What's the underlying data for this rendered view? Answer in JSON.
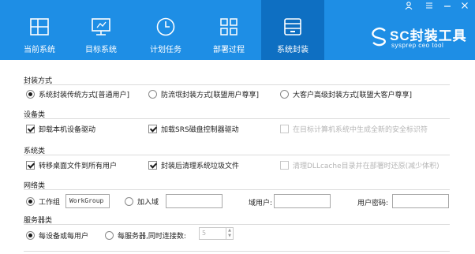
{
  "window": {
    "controls": [
      "user",
      "menu",
      "minimize",
      "close"
    ]
  },
  "tabs": [
    {
      "label": "当前系统",
      "icon": "windows-icon",
      "active": false
    },
    {
      "label": "目标系统",
      "icon": "monitor-icon",
      "active": false
    },
    {
      "label": "计划任务",
      "icon": "clock-icon",
      "active": false
    },
    {
      "label": "部署过程",
      "icon": "grid-icon",
      "active": false
    },
    {
      "label": "系统封装",
      "icon": "package-icon",
      "active": true
    }
  ],
  "logo": {
    "title": "SC封装工具",
    "subtitle": "sysprep ceo tool"
  },
  "packaging_mode": {
    "title": "封装方式",
    "options": [
      {
        "label": "系统封装传统方式[普通用户]",
        "checked": true
      },
      {
        "label": "防流氓封装方式[联盟用户尊享]",
        "checked": false
      },
      {
        "label": "大客户高级封装方式[联盟大客户尊享]",
        "checked": false
      }
    ]
  },
  "devices": {
    "title": "设备类",
    "options": [
      {
        "label": "卸载本机设备驱动",
        "checked": true,
        "enabled": true
      },
      {
        "label": "加载SRS磁盘控制器驱动",
        "checked": true,
        "enabled": true
      },
      {
        "label": "在目标计算机系统中生成全新的安全标识符",
        "checked": false,
        "enabled": false
      }
    ]
  },
  "system": {
    "title": "系统类",
    "options": [
      {
        "label": "转移桌面文件到所有用户",
        "checked": true,
        "enabled": true
      },
      {
        "label": "封装后清理系统垃圾文件",
        "checked": true,
        "enabled": true
      },
      {
        "label": "清理DLLcache目录并在部署时还原(减少体积)",
        "checked": false,
        "enabled": false
      }
    ]
  },
  "network": {
    "title": "网络类",
    "workgroup_label": "工作组",
    "workgroup_value": "WorkGroup",
    "domain_label": "加入域",
    "domain_value": "",
    "domain_user_label": "域用户:",
    "domain_user_value": "",
    "password_label": "用户密码:",
    "password_value": ""
  },
  "server": {
    "title": "服务器类",
    "per_device_label": "每设备或每用户",
    "per_server_label": "每服务器,同时连接数:",
    "connections_value": "5"
  }
}
